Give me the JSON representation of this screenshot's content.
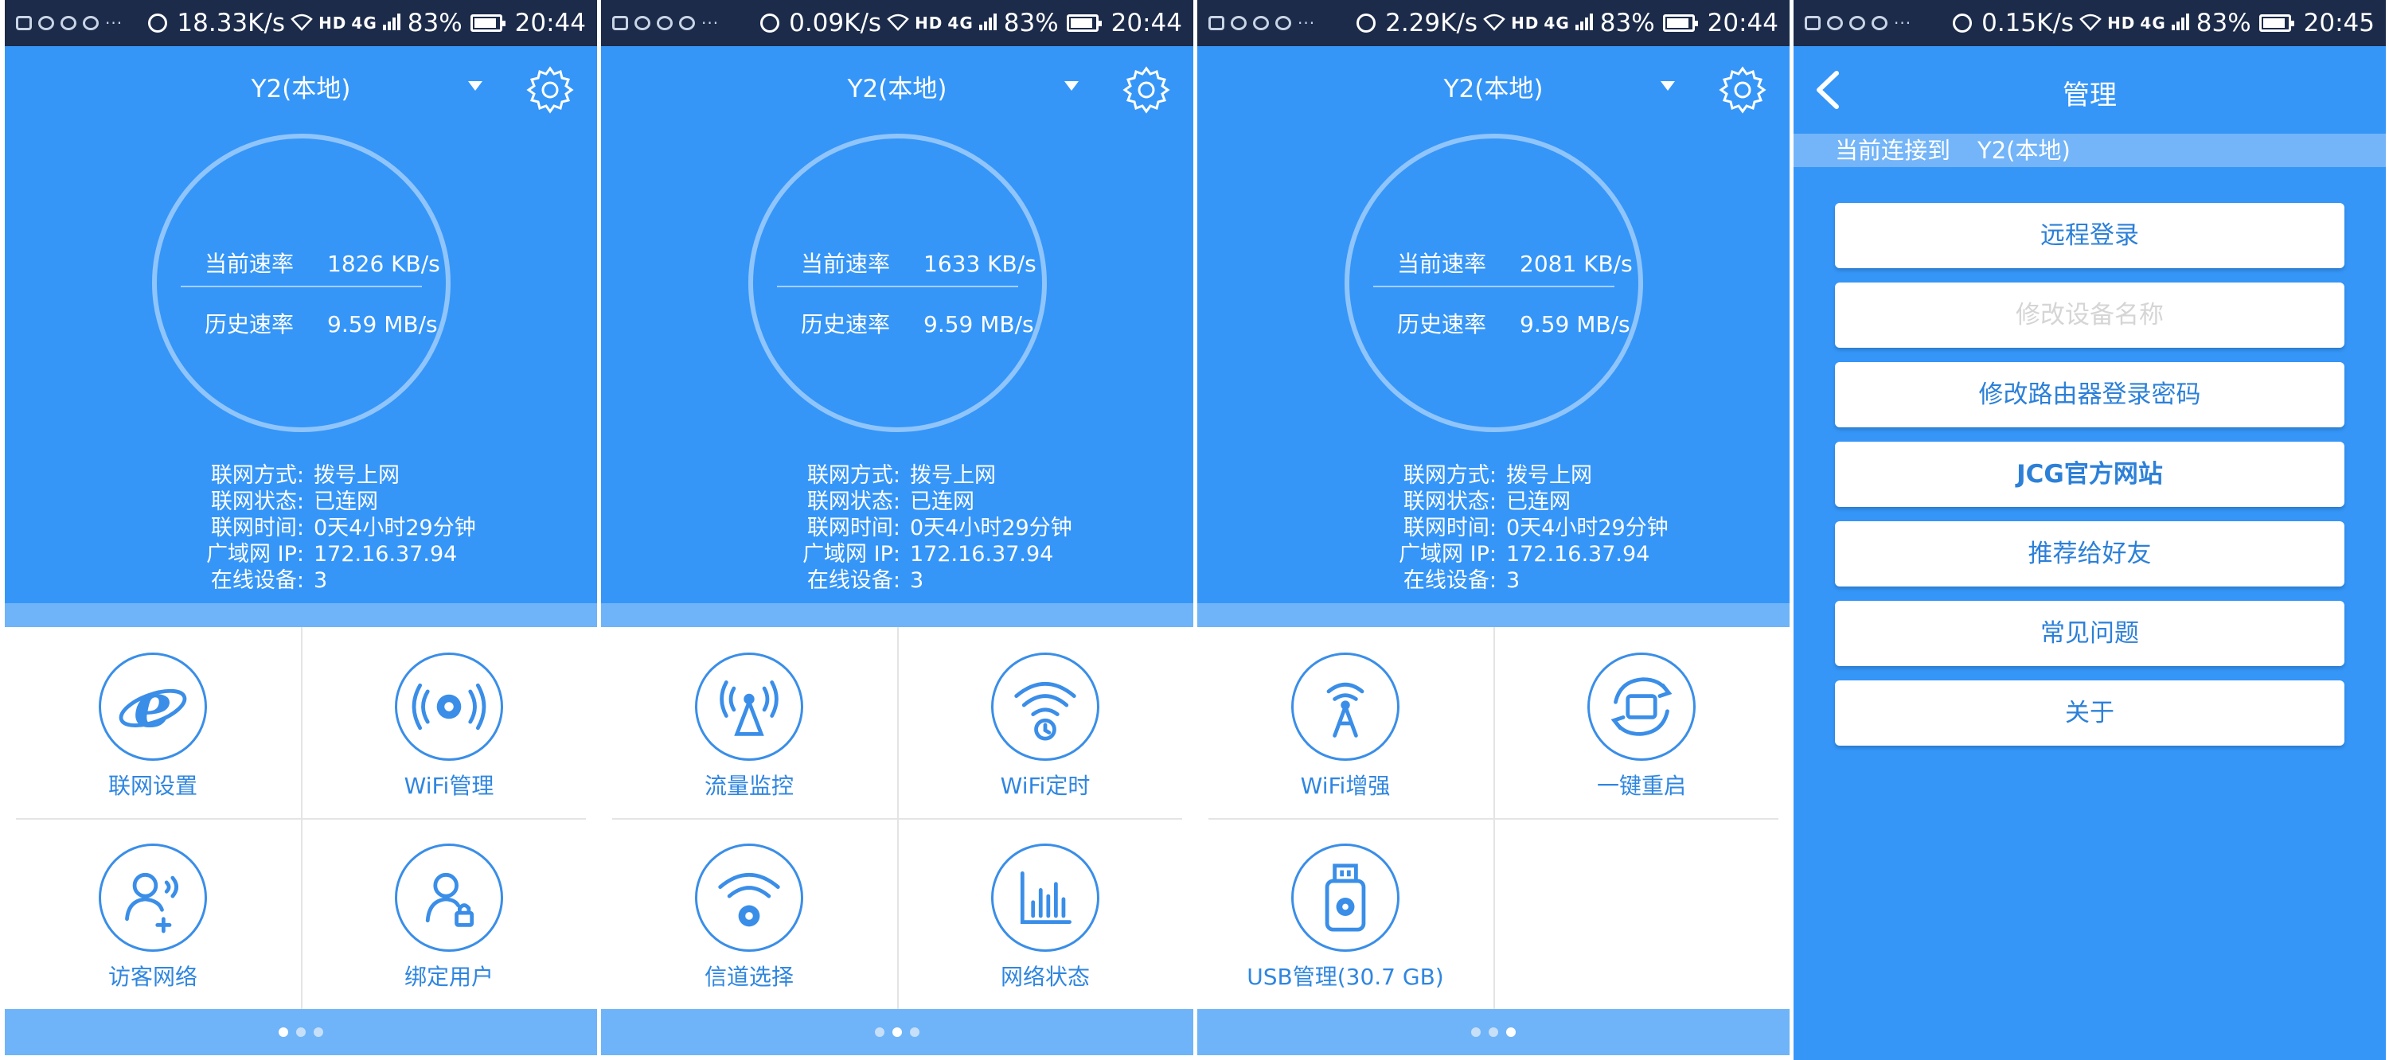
{
  "phones": [
    {
      "status": {
        "speed": "18.33K/s",
        "hd": "HD",
        "sig": "4G",
        "battery": "83%",
        "time": "20:44"
      },
      "device": "Y2(本地)",
      "current_rate": {
        "label": "当前速率",
        "value": "1826 KB/s"
      },
      "history_rate": {
        "label": "历史速率",
        "value": "9.59 MB/s"
      },
      "info": [
        {
          "key": "联网方式:",
          "value": "拨号上网"
        },
        {
          "key": "联网状态:",
          "value": "已连网"
        },
        {
          "key": "联网时间:",
          "value": "0天4小时29分钟"
        },
        {
          "key": "广域网 IP:",
          "value": "172.16.37.94"
        },
        {
          "key": "在线设备:",
          "value": "3"
        }
      ],
      "tiles": [
        {
          "label": "联网设置",
          "icon": "ie-icon"
        },
        {
          "label": "WiFi管理",
          "icon": "wifi-gear-icon"
        },
        {
          "label": "访客网络",
          "icon": "guest-user-icon"
        },
        {
          "label": "绑定用户",
          "icon": "user-lock-icon"
        }
      ],
      "page": 0
    },
    {
      "status": {
        "speed": "0.09K/s",
        "hd": "HD",
        "sig": "4G",
        "battery": "83%",
        "time": "20:44"
      },
      "device": "Y2(本地)",
      "current_rate": {
        "label": "当前速率",
        "value": "1633 KB/s"
      },
      "history_rate": {
        "label": "历史速率",
        "value": "9.59 MB/s"
      },
      "info": [
        {
          "key": "联网方式:",
          "value": "拨号上网"
        },
        {
          "key": "联网状态:",
          "value": "已连网"
        },
        {
          "key": "联网时间:",
          "value": "0天4小时29分钟"
        },
        {
          "key": "广域网 IP:",
          "value": "172.16.37.94"
        },
        {
          "key": "在线设备:",
          "value": "3"
        }
      ],
      "tiles": [
        {
          "label": "流量监控",
          "icon": "antenna-icon"
        },
        {
          "label": "WiFi定时",
          "icon": "wifi-clock-icon"
        },
        {
          "label": "信道选择",
          "icon": "wifi-gear-channel-icon"
        },
        {
          "label": "网络状态",
          "icon": "bar-chart-icon"
        }
      ],
      "page": 1
    },
    {
      "status": {
        "speed": "2.29K/s",
        "hd": "HD",
        "sig": "4G",
        "battery": "83%",
        "time": "20:44"
      },
      "device": "Y2(本地)",
      "current_rate": {
        "label": "当前速率",
        "value": "2081 KB/s"
      },
      "history_rate": {
        "label": "历史速率",
        "value": "9.59 MB/s"
      },
      "info": [
        {
          "key": "联网方式:",
          "value": "拨号上网"
        },
        {
          "key": "联网状态:",
          "value": "已连网"
        },
        {
          "key": "联网时间:",
          "value": "0天4小时29分钟"
        },
        {
          "key": "广域网 IP:",
          "value": "172.16.37.94"
        },
        {
          "key": "在线设备:",
          "value": "3"
        }
      ],
      "tiles": [
        {
          "label": "WiFi增强",
          "icon": "tower-icon"
        },
        {
          "label": "一键重启",
          "icon": "router-restart-icon"
        },
        {
          "label": "USB管理(30.7 GB)",
          "icon": "usb-gear-icon"
        }
      ],
      "page": 2
    }
  ],
  "manage": {
    "status": {
      "speed": "0.15K/s",
      "hd": "HD",
      "sig": "4G",
      "battery": "83%",
      "time": "20:45"
    },
    "title": "管理",
    "connected_label": "当前连接到",
    "connected_device": "Y2(本地)",
    "buttons": [
      {
        "label": "远程登录",
        "disabled": false,
        "bold": false
      },
      {
        "label": "修改设备名称",
        "disabled": true,
        "bold": false
      },
      {
        "label": "修改路由器登录密码",
        "disabled": false,
        "bold": false
      },
      {
        "label": "JCG官方网站",
        "disabled": false,
        "bold": true
      },
      {
        "label": "推荐给好友",
        "disabled": false,
        "bold": false
      },
      {
        "label": "常见问题",
        "disabled": false,
        "bold": false
      },
      {
        "label": "关于",
        "disabled": false,
        "bold": false
      }
    ]
  },
  "colors": {
    "primary": "#3596f8",
    "light": "#6fb4f8",
    "icon": "#3a8ee8",
    "label": "#2f86e0",
    "statusbar": "#1c2b4a"
  }
}
